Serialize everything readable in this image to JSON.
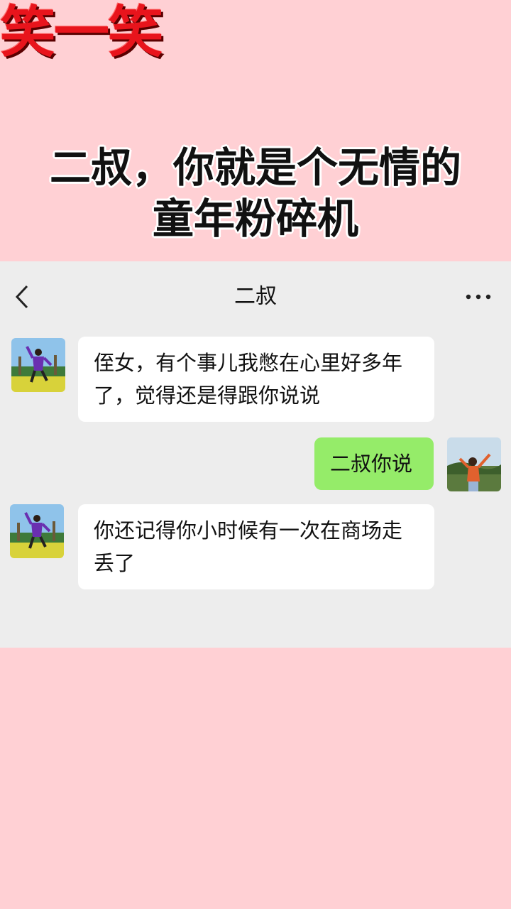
{
  "brand": "笑一笑",
  "headline": [
    "二叔，你就是个无情的",
    "童年粉碎机"
  ],
  "chat": {
    "title": "二叔",
    "back_icon": "chevron-left-icon",
    "more_icon": "more-dots-icon",
    "messages": [
      {
        "sender": "uncle",
        "lines": [
          "侄女，有个事儿我憋在心里好多年",
          "了，觉得还是得跟你说说"
        ]
      },
      {
        "sender": "me",
        "lines": [
          "二叔你说"
        ]
      },
      {
        "sender": "uncle",
        "lines": [
          "你还记得你小时候有一次在商场走",
          "丢了"
        ]
      }
    ]
  },
  "colors": {
    "page_bg": "#ffd0d4",
    "chat_bg": "#ededed",
    "my_bubble": "#95ec69",
    "other_bubble": "#ffffff",
    "brand": "#e8141c"
  }
}
